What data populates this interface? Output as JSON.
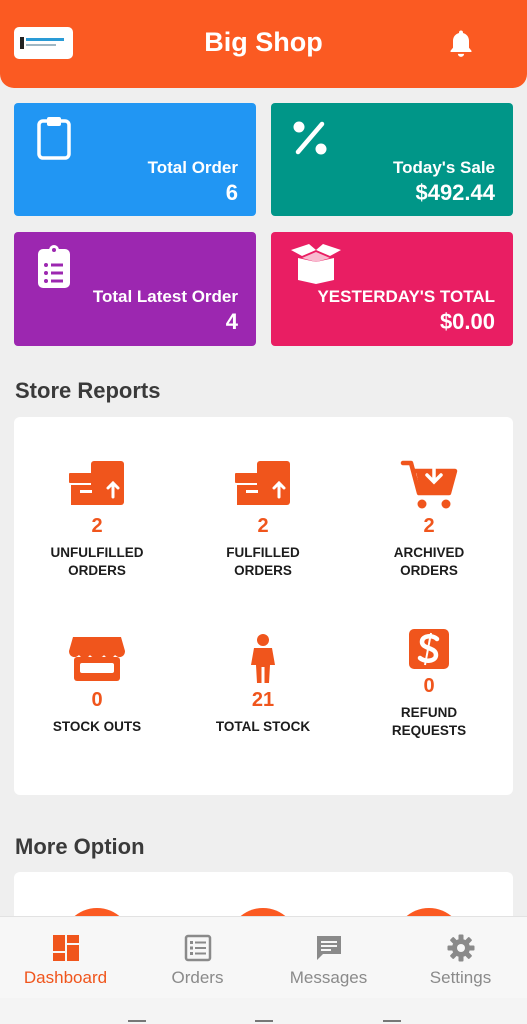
{
  "header": {
    "title": "Big Shop",
    "logo": "shop-logo",
    "icon": "bell-icon"
  },
  "summary": [
    {
      "label": "Total Order",
      "value": "6",
      "icon": "clipboard-icon",
      "color": "#2196f3"
    },
    {
      "label": "Today's Sale",
      "value": "$492.44",
      "icon": "percent-icon",
      "color": "#009688"
    },
    {
      "label": "Total Latest Order",
      "value": "4",
      "icon": "clipboard-list-icon",
      "color": "#9c27b0"
    },
    {
      "label": "YESTERDAY'S TOTAL",
      "value": "$0.00",
      "icon": "open-box-icon",
      "color": "#e91e63"
    }
  ],
  "store_reports": {
    "title": "Store Reports",
    "items": [
      {
        "count": "2",
        "label_line1": "UNFULFILLED",
        "label_line2": "ORDERS",
        "icon": "box-upload-icon"
      },
      {
        "count": "2",
        "label_line1": "FULFILLED",
        "label_line2": "ORDERS",
        "icon": "box-upload-icon"
      },
      {
        "count": "2",
        "label_line1": "ARCHIVED",
        "label_line2": "ORDERS",
        "icon": "cart-download-icon"
      },
      {
        "count": "0",
        "label_line1": "STOCK OUTS",
        "label_line2": "",
        "icon": "storefront-icon"
      },
      {
        "count": "21",
        "label_line1": "TOTAL STOCK",
        "label_line2": "",
        "icon": "person-icon"
      },
      {
        "count": "0",
        "label_line1": "REFUND",
        "label_line2": "REQUESTS",
        "icon": "refund-s-icon"
      }
    ]
  },
  "more_option": {
    "title": "More Option"
  },
  "bottom_nav": [
    {
      "label": "Dashboard",
      "icon": "dashboard-icon",
      "active": true
    },
    {
      "label": "Orders",
      "icon": "orders-list-icon",
      "active": false
    },
    {
      "label": "Messages",
      "icon": "message-icon",
      "active": false
    },
    {
      "label": "Settings",
      "icon": "gear-icon",
      "active": false
    }
  ],
  "colors": {
    "brand": "#fb5a22",
    "accent_text": "#f0551c",
    "background": "#efefef"
  }
}
